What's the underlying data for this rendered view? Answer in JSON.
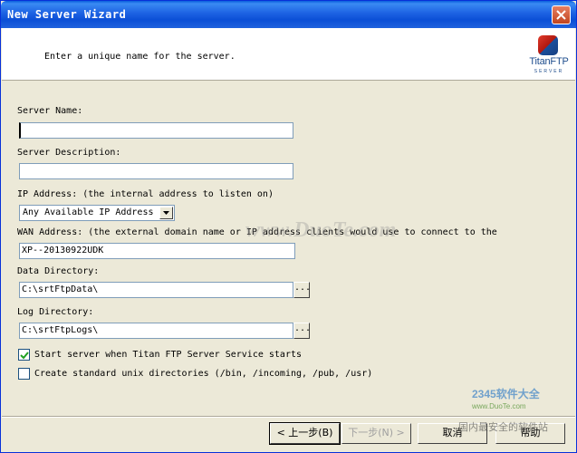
{
  "window": {
    "title": "New Server Wizard"
  },
  "header": {
    "instruction": "Enter a unique name for the server.",
    "logo_text": "TitanFTP",
    "logo_sub": "SERVER"
  },
  "form": {
    "server_name": {
      "label": "Server Name:",
      "value": ""
    },
    "server_description": {
      "label": "Server Description:",
      "value": ""
    },
    "ip_address": {
      "label": "IP Address: (the internal address to listen on)",
      "selected": "Any Available IP Address"
    },
    "wan_address": {
      "label": "WAN Address: (the external domain name or IP address clients would use to connect to the",
      "value": "XP--20130922UDK"
    },
    "data_directory": {
      "label": "Data Directory:",
      "value": "C:\\srtFtpData\\",
      "browse": "..."
    },
    "log_directory": {
      "label": "Log Directory:",
      "value": "C:\\srtFtpLogs\\",
      "browse": "..."
    },
    "start_server": {
      "label": "Start server when Titan FTP Server Service starts",
      "checked": true
    },
    "create_unix_dirs": {
      "label": "Create standard unix directories (/bin, /incoming, /pub, /usr)",
      "checked": false
    }
  },
  "buttons": {
    "back": "< 上一步(B)",
    "next": "下一步(N) >",
    "cancel": "取消",
    "help": "帮助"
  },
  "watermarks": {
    "center": "www.DuoTe.com",
    "brand": "2345软件大全",
    "brand_url": "www.DuoTe.com",
    "bottom": "国内最安全的软件站"
  }
}
